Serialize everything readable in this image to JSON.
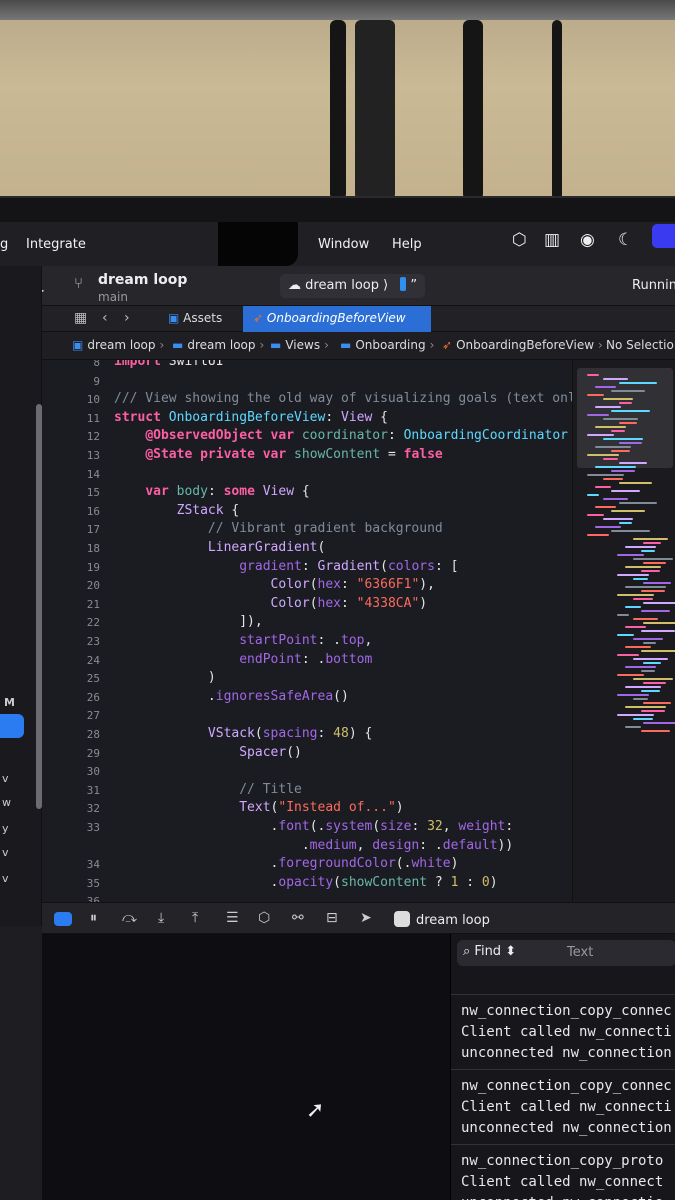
{
  "menubar": {
    "items": [
      "g",
      "Integrate",
      "Window",
      "Help"
    ]
  },
  "toolbar": {
    "project": "dream loop",
    "branch": "main",
    "scheme": "dream loop",
    "scheme_sep": "⟩",
    "device_quote": "”",
    "status": "Running"
  },
  "tabs": [
    {
      "label": "Assets",
      "active": false
    },
    {
      "label": "OnboardingBeforeView",
      "active": true
    }
  ],
  "jumpbar": {
    "crumbs": [
      "dream loop",
      "dream loop",
      "Views",
      "Onboarding",
      "OnboardingBeforeView",
      "No Selection"
    ]
  },
  "navigator": {
    "letters": [
      "M",
      "v",
      "w",
      "y",
      "v",
      "v"
    ]
  },
  "editor": {
    "lines": [
      {
        "n": "8",
        "html": "<span class=\"k\">import</span> SwiftUI"
      },
      {
        "n": "9",
        "html": ""
      },
      {
        "n": "10",
        "html": "<span class=\"c\">/// View showing the old way of visualizing goals (text only)</span>"
      },
      {
        "n": "11",
        "html": "<span class=\"k\">struct</span> <span class=\"ty\">OnboardingBeforeView</span>: <span class=\"t\">View</span> {"
      },
      {
        "n": "12",
        "html": "    <span class=\"k\">@ObservedObject</span> <span class=\"k\">var</span> <span class=\"v\">coordinator</span>: <span class=\"ty\">OnboardingCoordinator</span>"
      },
      {
        "n": "13",
        "html": "    <span class=\"k\">@State</span> <span class=\"k\">private</span> <span class=\"k\">var</span> <span class=\"v\">showContent</span> = <span class=\"k\">false</span>"
      },
      {
        "n": "14",
        "html": ""
      },
      {
        "n": "15",
        "html": "    <span class=\"k\">var</span> <span class=\"v\">body</span>: <span class=\"k\">some</span> <span class=\"t\">View</span> {"
      },
      {
        "n": "16",
        "html": "        <span class=\"t\">ZStack</span> {"
      },
      {
        "n": "17",
        "html": "            <span class=\"c\">// Vibrant gradient background</span>"
      },
      {
        "n": "18",
        "html": "            <span class=\"t\">LinearGradient</span>("
      },
      {
        "n": "19",
        "html": "                <span class=\"m\">gradient</span>: <span class=\"t\">Gradient</span>(<span class=\"m\">colors</span>: ["
      },
      {
        "n": "20",
        "html": "                    <span class=\"t\">Color</span>(<span class=\"m\">hex</span>: <span class=\"s\">\"6366F1\"</span>),"
      },
      {
        "n": "21",
        "html": "                    <span class=\"t\">Color</span>(<span class=\"m\">hex</span>: <span class=\"s\">\"4338CA\"</span>)"
      },
      {
        "n": "22",
        "html": "                ]),"
      },
      {
        "n": "23",
        "html": "                <span class=\"m\">startPoint</span>: .<span class=\"m\">top</span>,"
      },
      {
        "n": "24",
        "html": "                <span class=\"m\">endPoint</span>: .<span class=\"m\">bottom</span>"
      },
      {
        "n": "25",
        "html": "            )"
      },
      {
        "n": "26",
        "html": "            .<span class=\"m\">ignoresSafeArea</span>()"
      },
      {
        "n": "27",
        "html": ""
      },
      {
        "n": "28",
        "html": "            <span class=\"t\">VStack</span>(<span class=\"m\">spacing</span>: <span class=\"n\">48</span>) {"
      },
      {
        "n": "29",
        "html": "                <span class=\"t\">Spacer</span>()"
      },
      {
        "n": "30",
        "html": ""
      },
      {
        "n": "31",
        "html": "                <span class=\"c\">// Title</span>"
      },
      {
        "n": "32",
        "html": "                <span class=\"t\">Text</span>(<span class=\"s\">\"Instead of...\"</span>)"
      },
      {
        "n": "33",
        "html": "                    .<span class=\"m\">font</span>(.<span class=\"m\">system</span>(<span class=\"m\">size</span>: <span class=\"n\">32</span>, <span class=\"m\">weight</span>:"
      },
      {
        "n": "",
        "html": "                        .<span class=\"m\">medium</span>, <span class=\"m\">design</span>: .<span class=\"m\">default</span>))"
      },
      {
        "n": "34",
        "html": "                    .<span class=\"m\">foregroundColor</span>(.<span class=\"m\">white</span>)"
      },
      {
        "n": "35",
        "html": "                    .<span class=\"m\">opacity</span>(<span class=\"v\">showContent</span> ? <span class=\"n\">1</span> : <span class=\"n\">0</span>)"
      },
      {
        "n": "36",
        "html": ""
      }
    ]
  },
  "debugbar": {
    "app": "dream loop"
  },
  "console": {
    "find_label": "Find",
    "find_chevron": "⬍",
    "find_placeholder": "Text",
    "blocks": [
      [
        "nw_connection_copy_connec",
        "Client called nw_connecti",
        "unconnected nw_connection"
      ],
      [
        "nw_connection_copy_connec",
        "Client called nw_connecti",
        "unconnected nw_connection"
      ],
      [
        "nw_connection_copy_proto",
        "Client called nw_connect",
        "unconnected nw_connectio"
      ]
    ]
  },
  "colors": {
    "accent": "#2b6fd6",
    "keyword": "#fc5fa3",
    "string": "#fc6a5d",
    "type": "#5dd8ff",
    "comment": "#7f8c98"
  },
  "icons": [
    "play-icon",
    "branch-icon",
    "app-icon",
    "grid-icon",
    "chevron-left-icon",
    "chevron-right-icon",
    "folder-icon",
    "swift-icon",
    "find-icon",
    "cursor-icon"
  ]
}
